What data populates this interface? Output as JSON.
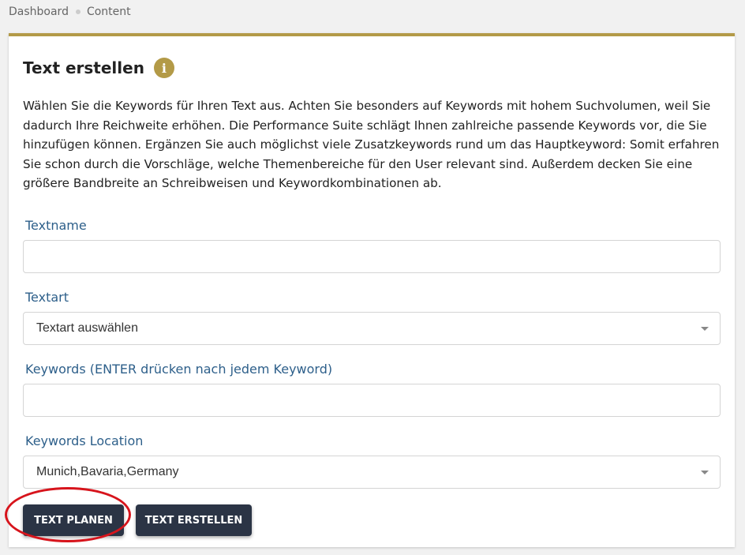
{
  "breadcrumb": {
    "items": [
      "Dashboard",
      "Content"
    ]
  },
  "card": {
    "title": "Text erstellen",
    "info_icon": "info-icon",
    "description": "Wählen Sie die Keywords für Ihren Text aus. Achten Sie besonders auf Keywords mit hohem Suchvolumen, weil Sie dadurch Ihre Reichweite erhöhen. Die Performance Suite schlägt Ihnen zahlreiche passende Keywords vor, die Sie hinzufügen können. Ergänzen Sie auch möglichst viele Zusatzkeywords rund um das Hauptkeyword: Somit erfahren Sie schon durch die Vorschläge, welche Themenbereiche für den User relevant sind. Außerdem decken Sie eine größere Bandbreite an Schreibweisen und Keywordkombinationen ab."
  },
  "form": {
    "textname": {
      "label": "Textname",
      "value": ""
    },
    "textart": {
      "label": "Textart",
      "selected": "Textart auswählen"
    },
    "keywords": {
      "label": "Keywords (ENTER drücken nach jedem Keyword)",
      "value": ""
    },
    "location": {
      "label": "Keywords Location",
      "selected": "Munich,Bavaria,Germany"
    }
  },
  "buttons": {
    "plan": "TEXT PLANEN",
    "create": "TEXT ERSTELLEN"
  },
  "colors": {
    "accent": "#b39a47",
    "label": "#2d5f8a",
    "button_bg": "#2b3445",
    "highlight": "#d7141c"
  }
}
